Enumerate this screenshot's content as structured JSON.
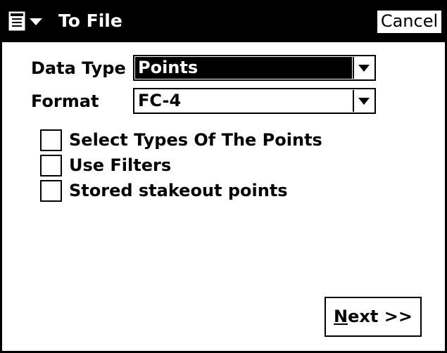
{
  "titlebar": {
    "title": "To File",
    "menu_icon": "start-menu-icon",
    "cancel_label": "Cancel"
  },
  "form": {
    "data_type": {
      "label": "Data Type",
      "value": "Points"
    },
    "format": {
      "label": "Format",
      "value": "FC-4"
    }
  },
  "checkboxes": [
    {
      "label": "Select Types Of The Points",
      "checked": false
    },
    {
      "label": "Use Filters",
      "checked": false
    },
    {
      "label": "Stored stakeout points",
      "checked": false
    }
  ],
  "footer": {
    "next_mnemonic": "N",
    "next_rest": "ext >>"
  },
  "colors": {
    "titlebar_bg": "#000000",
    "window_bg": "#ffffff",
    "selection_bg": "#000000"
  }
}
